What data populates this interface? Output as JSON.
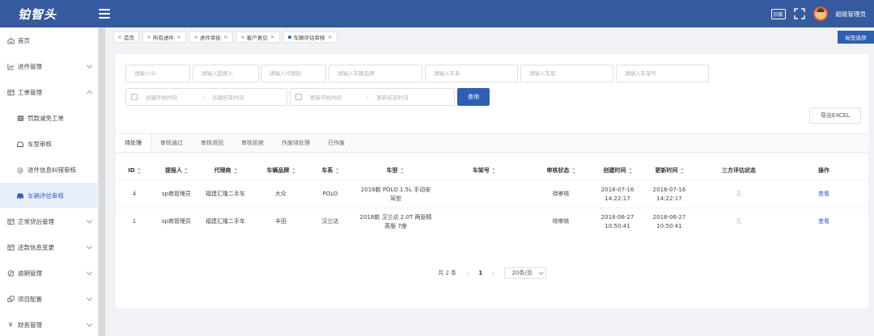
{
  "header": {
    "logo_text": "铂智头",
    "notify_label": "旧版",
    "admin_name": "超级管理员"
  },
  "sidebar": {
    "items": [
      {
        "label": "首页",
        "icon": "home-icon",
        "level": 1,
        "expandable": false
      },
      {
        "label": "进件管理",
        "icon": "chart-icon",
        "level": 1,
        "expandable": true
      },
      {
        "label": "工单管理",
        "icon": "table-icon",
        "level": 1,
        "expandable": true
      },
      {
        "label": "罚款减免工单",
        "icon": "list-icon",
        "level": 2,
        "expandable": false
      },
      {
        "label": "车型审核",
        "icon": "car-icon",
        "level": 2,
        "expandable": false
      },
      {
        "label": "进件信息纠错审核",
        "icon": "at-icon",
        "level": 2,
        "expandable": false
      },
      {
        "label": "车辆评估审核",
        "icon": "car-icon",
        "level": 2,
        "expandable": false,
        "active": true
      },
      {
        "label": "正常贷后管理",
        "icon": "table-icon",
        "level": 1,
        "expandable": true
      },
      {
        "label": "还款信息变更",
        "icon": "table-icon",
        "level": 1,
        "expandable": true
      },
      {
        "label": "逾期管理",
        "icon": "circle-icon",
        "level": 1,
        "expandable": true
      },
      {
        "label": "项目配置",
        "icon": "config-icon",
        "level": 1,
        "expandable": true
      },
      {
        "label": "财务管理",
        "icon": "yen-icon",
        "level": 1,
        "expandable": true
      }
    ]
  },
  "tabs": [
    {
      "label": "首页",
      "closable": false,
      "active": false
    },
    {
      "label": "所有进件",
      "closable": true,
      "active": false
    },
    {
      "label": "进件审批",
      "closable": true,
      "active": false
    },
    {
      "label": "客户意见",
      "closable": true,
      "active": false
    },
    {
      "label": "车辆评估审核",
      "closable": true,
      "active": true
    }
  ],
  "tab_action": "标签选项",
  "filters": {
    "id_placeholder": "请输入ID",
    "applicant_placeholder": "请输入提报人",
    "agent_placeholder": "请输入代理商",
    "brand_placeholder": "请输入车辆品牌",
    "series_placeholder": "请输入车系",
    "model_placeholder": "请输入车型",
    "frame_placeholder": "请输入车架号",
    "create_start": "创建开始时间",
    "create_end": "创建结束时间",
    "update_start": "更新开始时间",
    "update_end": "更新结束时间",
    "range_sep": "-",
    "query_label": "查询",
    "export_label": "导出EXCEL"
  },
  "subtabs": [
    {
      "label": "待处理",
      "active": true
    },
    {
      "label": "审核通过",
      "active": false
    },
    {
      "label": "审核退回",
      "active": false
    },
    {
      "label": "审核拒绝",
      "active": false
    },
    {
      "label": "作废待处理",
      "active": false
    },
    {
      "label": "已作废",
      "active": false
    }
  ],
  "table": {
    "columns": [
      "ID",
      "提报人",
      "代理商",
      "车辆品牌",
      "车系",
      "车型",
      "车架号",
      "审核状态",
      "创建时间",
      "更新时间",
      "三方评估状态",
      "操作"
    ],
    "rows": [
      {
        "id": "4",
        "applicant": "sp商管理员",
        "agent": "福建汇隆二手车",
        "brand": "大众",
        "series": "POLO",
        "model": "2018款 POLO 1.5L 手动安驾型",
        "frame": "",
        "status": "待审核",
        "created": "2018-07-16 14:22:17",
        "updated": "2018-07-16 14:22:17",
        "third_party": "无",
        "action": "查看"
      },
      {
        "id": "1",
        "applicant": "sp商管理员",
        "agent": "福建汇隆二手车",
        "brand": "丰田",
        "series": "汉兰达",
        "model": "2018款 汉兰达 2.0T 两驱精英版 7座",
        "frame": "",
        "status": "待审核",
        "created": "2018-06-27 10:50:41",
        "updated": "2018-06-27 10:50:41",
        "third_party": "无",
        "action": "查看"
      }
    ]
  },
  "pagination": {
    "total": "共 2 条",
    "prev": "‹",
    "current": "1",
    "next": "›",
    "page_size": "20条/页"
  },
  "colors": {
    "header": "#365a9e",
    "primary": "#2f5fb3",
    "active_bg": "#e8f0fb"
  }
}
